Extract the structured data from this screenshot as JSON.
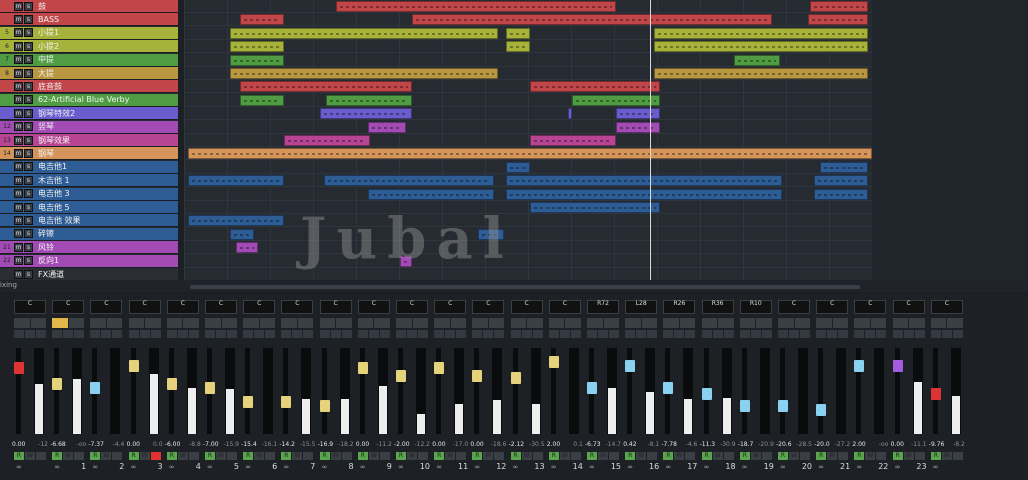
{
  "tracks": [
    {
      "num": "",
      "name": "鼓",
      "color": "#c0464a"
    },
    {
      "num": "",
      "name": "BASS",
      "color": "#c0464a"
    },
    {
      "num": "5",
      "name": "小提1",
      "color": "#a7b23b"
    },
    {
      "num": "6",
      "name": "小提2",
      "color": "#a7b23b"
    },
    {
      "num": "7",
      "name": "中提",
      "color": "#4f9c43"
    },
    {
      "num": "8",
      "name": "大提",
      "color": "#b99740"
    },
    {
      "num": "",
      "name": "底音鼓",
      "color": "#c0464a"
    },
    {
      "num": "",
      "name": "62-Artificial Blue Verby",
      "color": "#4f9c43"
    },
    {
      "num": "",
      "name": "钢琴特效2",
      "color": "#6a5ccc"
    },
    {
      "num": "12",
      "name": "竖琴",
      "color": "#a34bb4"
    },
    {
      "num": "13",
      "name": "钢琴效果",
      "color": "#b84593"
    },
    {
      "num": "14",
      "name": "钢琴",
      "color": "#d4945a"
    },
    {
      "num": "",
      "name": "电吉他1",
      "color": "#2e5c94"
    },
    {
      "num": "",
      "name": "木吉他 1",
      "color": "#2e5c94"
    },
    {
      "num": "",
      "name": "电吉他 3",
      "color": "#2e5c94"
    },
    {
      "num": "",
      "name": "电吉他 5",
      "color": "#2e5c94"
    },
    {
      "num": "",
      "name": "电吉他 效果",
      "color": "#2e5c94"
    },
    {
      "num": "",
      "name": "碎镲",
      "color": "#2e5c94"
    },
    {
      "num": "21",
      "name": "风铃",
      "color": "#a34bb4"
    },
    {
      "num": "22",
      "name": "反向1",
      "color": "#a34bb4"
    },
    {
      "num": "",
      "name": "FX通道",
      "color": "#2a2e33"
    }
  ],
  "ms_labels": {
    "m": "m",
    "s": "s"
  },
  "status_label": "ixing",
  "watermark": "Jubal",
  "channels": [
    {
      "num": "",
      "pan": "C",
      "fader": "-",
      "vol": "0.00",
      "peak": "-12",
      "fcolor": "#d33"
    },
    {
      "num": "1",
      "pan": "C",
      "fader": "-",
      "vol": "-6.68",
      "peak": "-oo",
      "fcolor": "#e6d27a"
    },
    {
      "num": "2",
      "pan": "C",
      "fader": "-",
      "vol": "-7.37",
      "peak": "-4.4",
      "fcolor": "#8ad0f0"
    },
    {
      "num": "3",
      "pan": "C",
      "fader": "-",
      "vol": "0.00",
      "peak": "0.0",
      "fcolor": "#e6d27a"
    },
    {
      "num": "4",
      "pan": "C",
      "fader": "-",
      "vol": "-6.00",
      "peak": "-8.8",
      "fcolor": "#e6d27a"
    },
    {
      "num": "5",
      "pan": "C",
      "fader": "-",
      "vol": "-7.00",
      "peak": "-15.9",
      "fcolor": "#e6d27a"
    },
    {
      "num": "6",
      "pan": "C",
      "fader": "-",
      "vol": "-15.4",
      "peak": "-16.1",
      "fcolor": "#e6d27a"
    },
    {
      "num": "7",
      "pan": "C",
      "fader": "-",
      "vol": "-14.2",
      "peak": "-15.5",
      "fcolor": "#e6d27a"
    },
    {
      "num": "8",
      "pan": "C",
      "fader": "-",
      "vol": "-16.9",
      "peak": "-18.2",
      "fcolor": "#e6d27a"
    },
    {
      "num": "9",
      "pan": "C",
      "fader": "-",
      "vol": "0.00",
      "peak": "-11.2",
      "fcolor": "#e6d27a"
    },
    {
      "num": "10",
      "pan": "C",
      "fader": "-",
      "vol": "-2.00",
      "peak": "-12.2",
      "fcolor": "#e6d27a"
    },
    {
      "num": "11",
      "pan": "C",
      "fader": "-",
      "vol": "0.00",
      "peak": "-17.0",
      "fcolor": "#e6d27a"
    },
    {
      "num": "12",
      "pan": "C",
      "fader": "-",
      "vol": "0.00",
      "peak": "-18.6",
      "fcolor": "#e6d27a"
    },
    {
      "num": "13",
      "pan": "C",
      "fader": "-",
      "vol": "-2.12",
      "peak": "-30.5",
      "fcolor": "#e6d27a"
    },
    {
      "num": "14",
      "pan": "C",
      "fader": "-",
      "vol": "2.00",
      "peak": "0.1",
      "fcolor": "#e6d27a"
    },
    {
      "num": "15",
      "pan": "R72",
      "fader": "-",
      "vol": "-6.73",
      "peak": "-14.7",
      "fcolor": "#8ad0f0"
    },
    {
      "num": "16",
      "pan": "L28",
      "fader": "-",
      "vol": "0.42",
      "peak": "-8.1",
      "fcolor": "#8ad0f0"
    },
    {
      "num": "17",
      "pan": "R26",
      "fader": "-",
      "vol": "-7.78",
      "peak": "-4.6",
      "fcolor": "#8ad0f0"
    },
    {
      "num": "18",
      "pan": "R36",
      "fader": "-",
      "vol": "-11.3",
      "peak": "-30.9",
      "fcolor": "#8ad0f0"
    },
    {
      "num": "19",
      "pan": "R10",
      "fader": "-",
      "vol": "-18.7",
      "peak": "-20.9",
      "fcolor": "#8ad0f0"
    },
    {
      "num": "20",
      "pan": "C",
      "fader": "-",
      "vol": "-20.6",
      "peak": "-28.5",
      "fcolor": "#8ad0f0"
    },
    {
      "num": "21",
      "pan": "C",
      "fader": "-",
      "vol": "-20.0",
      "peak": "-27.2",
      "fcolor": "#8ad0f0"
    },
    {
      "num": "22",
      "pan": "C",
      "fader": "-",
      "vol": "2.00",
      "peak": "-oo",
      "fcolor": "#8ad0f0"
    },
    {
      "num": "23",
      "pan": "C",
      "fader": "-",
      "vol": "0.00",
      "peak": "-11.1",
      "fcolor": "#a35ce0"
    },
    {
      "num": "",
      "pan": "C",
      "fader": "-",
      "vol": "-9.76",
      "peak": "-8.2",
      "fcolor": "#d33"
    }
  ]
}
